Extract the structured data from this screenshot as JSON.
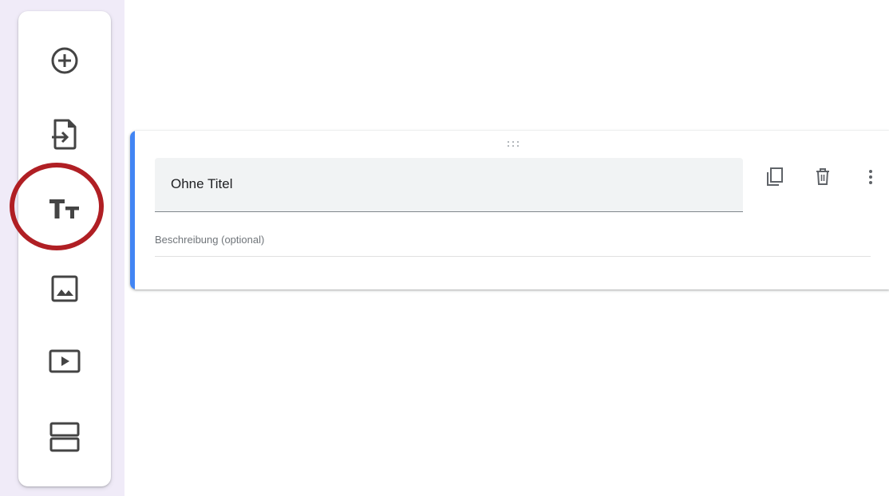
{
  "toolbar": {
    "items": [
      {
        "icon": "add-circle-icon",
        "label": "Frage hinzufügen"
      },
      {
        "icon": "import-icon",
        "label": "Fragen importieren"
      },
      {
        "icon": "title-icon",
        "label": "Titel und Beschreibung hinzufügen",
        "highlighted": true
      },
      {
        "icon": "image-icon",
        "label": "Bild hinzufügen"
      },
      {
        "icon": "video-icon",
        "label": "Video hinzufügen"
      },
      {
        "icon": "section-icon",
        "label": "Abschnitt hinzufügen"
      }
    ]
  },
  "card": {
    "title_value": "Ohne Titel",
    "description_placeholder": "Beschreibung (optional)",
    "accent_color": "#4285f4",
    "actions": [
      "duplicate-icon",
      "delete-icon",
      "more-vert-icon"
    ]
  },
  "annotation": {
    "highlight_color": "#b01f24"
  }
}
